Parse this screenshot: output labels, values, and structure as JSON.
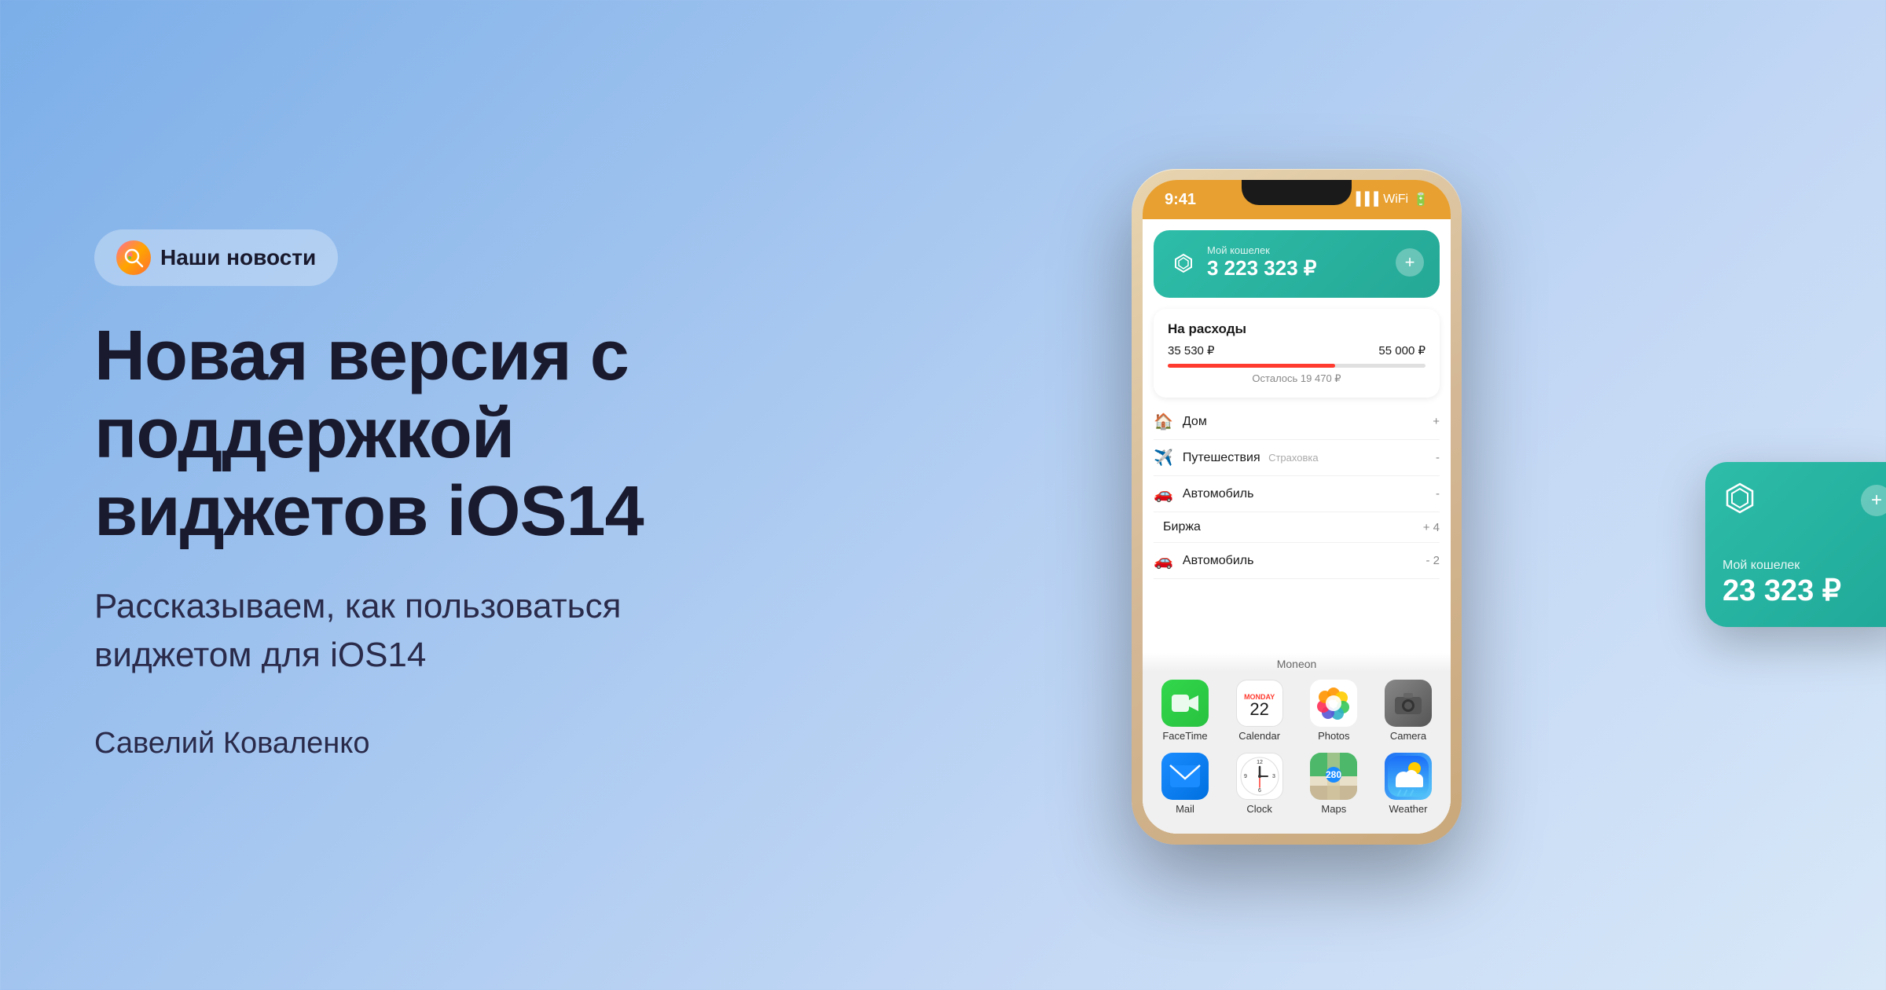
{
  "background": {
    "gradient_start": "#7baee8",
    "gradient_end": "#d8e8f8"
  },
  "badge": {
    "icon": "🔍",
    "label": "Наши новости"
  },
  "title": "Новая версия с поддержкой виджетов iOS14",
  "subtitle": "Рассказываем, как пользоваться\nвиджетом для iOS14",
  "author": "Савелий Коваленко",
  "phone": {
    "status_time": "9:41",
    "moneon_widget": {
      "label": "Мой кошелек",
      "amount": "3 223 323 ₽"
    },
    "expense": {
      "title": "На расходы",
      "spent": "35 530 ₽",
      "total": "55 000 ₽",
      "remaining": "Осталось 19 470 ₽",
      "progress_percent": 65
    },
    "transactions": [
      {
        "icon": "🏠",
        "name": "Дом",
        "tag": "",
        "amount": "+"
      },
      {
        "icon": "✈️",
        "name": "Путешествия",
        "tag": "Страховка",
        "amount": "-"
      },
      {
        "icon": "🚗",
        "name": "Автомобиль",
        "tag": "",
        "amount": "-"
      },
      {
        "icon": "",
        "name": "Биржа",
        "tag": "",
        "amount": "+4"
      },
      {
        "icon": "🚗",
        "name": "Автомобиль",
        "tag": "",
        "amount": "-2"
      }
    ],
    "app_label": "Moneon",
    "apps_row1": [
      {
        "id": "facetime",
        "label": "FaceTime"
      },
      {
        "id": "calendar",
        "label": "Calendar",
        "day_name": "Monday",
        "day_num": "22"
      },
      {
        "id": "photos",
        "label": "Photos"
      },
      {
        "id": "camera",
        "label": "Camera"
      }
    ],
    "apps_row2": [
      {
        "id": "mail",
        "label": "Mail"
      },
      {
        "id": "clock",
        "label": "Clock"
      },
      {
        "id": "maps",
        "label": "Maps"
      },
      {
        "id": "weather",
        "label": "Weather"
      }
    ]
  },
  "widget_overlay": {
    "label": "Мой кошелек",
    "amount": "23 323 ₽"
  }
}
